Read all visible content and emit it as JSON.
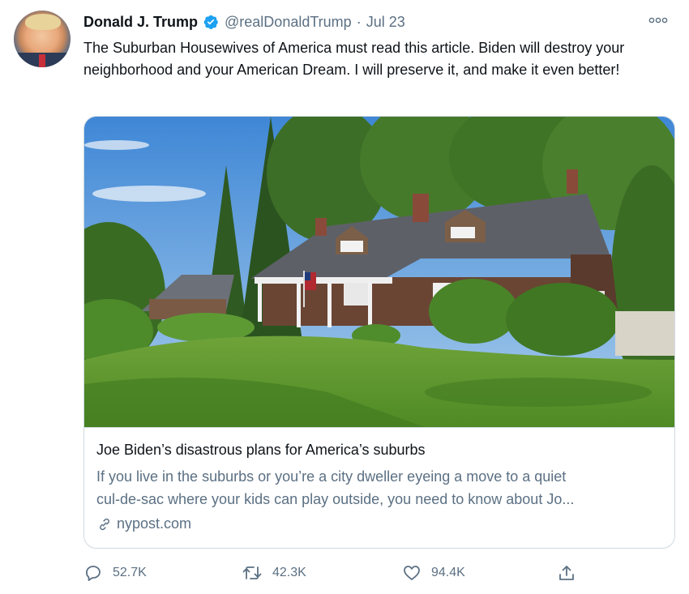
{
  "tweet": {
    "author_name": "Donald J. Trump",
    "handle": "@realDonaldTrump",
    "separator": "·",
    "date": "Jul 23",
    "verified": true,
    "text": "The Suburban Housewives of America must read this article. Biden will destroy your neighborhood and your American Dream. I will preserve it, and make it even better!"
  },
  "card": {
    "title": "Joe Biden’s disastrous plans for America’s suburbs",
    "description_line1": "If you live in the suburbs or you’re a city dweller eyeing a move to a quiet",
    "description_line2": "cul-de-sac where your kids can play outside, you need to know about Jo...",
    "domain": "nypost.com"
  },
  "actions": {
    "reply_count": "52.7K",
    "retweet_count": "42.3K",
    "like_count": "94.4K"
  },
  "icons": {
    "verified": "verified-badge-icon",
    "more": "more-options-icon",
    "link": "link-icon",
    "reply": "reply-icon",
    "retweet": "retweet-icon",
    "like": "heart-icon",
    "share": "share-icon"
  },
  "colors": {
    "text_primary": "#0f1419",
    "text_secondary": "#5b7083",
    "verified_blue": "#1da1f2",
    "border": "#cfd9de"
  }
}
